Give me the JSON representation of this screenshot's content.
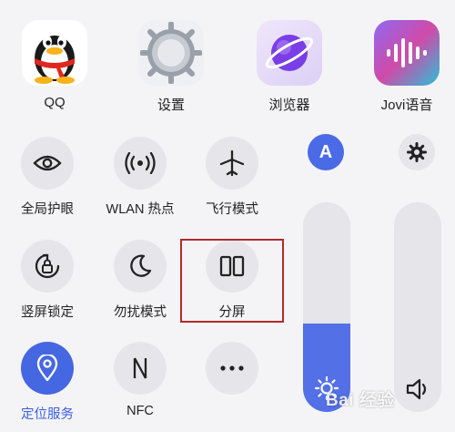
{
  "apps": [
    {
      "name": "QQ",
      "icon": "qq-penguin-icon"
    },
    {
      "name": "设置",
      "icon": "settings-gear-icon"
    },
    {
      "name": "浏览器",
      "icon": "browser-planet-icon"
    },
    {
      "name": "Jovi语音",
      "icon": "jovi-voice-icon"
    }
  ],
  "tiles": [
    {
      "label": "全局护眼",
      "icon": "eye-icon",
      "active": false
    },
    {
      "label": "WLAN 热点",
      "icon": "hotspot-icon",
      "active": false
    },
    {
      "label": "飞行模式",
      "icon": "airplane-icon",
      "active": false
    },
    {
      "label": "竖屏锁定",
      "icon": "rotation-lock-icon",
      "active": false
    },
    {
      "label": "勿扰模式",
      "icon": "moon-icon",
      "active": false
    },
    {
      "label": "分屏",
      "icon": "split-screen-icon",
      "active": false
    },
    {
      "label": "定位服务",
      "icon": "location-pin-icon",
      "active": true
    },
    {
      "label": "NFC",
      "icon": "nfc-icon",
      "active": false
    },
    {
      "label": "",
      "icon": "more-dots-icon",
      "active": false
    }
  ],
  "brightness": {
    "auto_label": "A",
    "level": 0.42,
    "icon": "sun-icon"
  },
  "volume": {
    "level": 0.0,
    "icon": "speaker-icon"
  },
  "gear_icon": "gear-icon",
  "watermark": "Bai 经验",
  "colors": {
    "accent": "#4a6ae6",
    "highlight_box": "#b22a2a",
    "tile_bg": "#e6e6ea"
  }
}
